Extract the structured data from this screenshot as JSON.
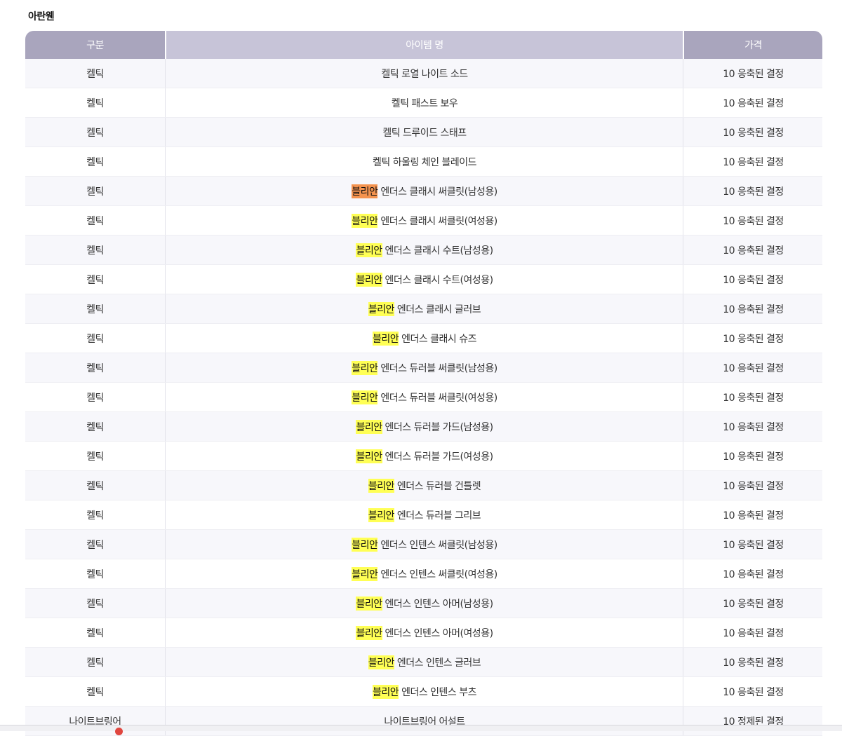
{
  "section_title": "아란웬",
  "table": {
    "headers": [
      "구분",
      "아이템 명",
      "가격"
    ],
    "rows": [
      {
        "category": "켈틱",
        "highlight": "",
        "name": "켈틱 로열 나이트 소드",
        "price": "10 응축된 결정"
      },
      {
        "category": "켈틱",
        "highlight": "",
        "name": "켈틱 패스트 보우",
        "price": "10 응축된 결정"
      },
      {
        "category": "켈틱",
        "highlight": "",
        "name": "켈틱 드루이드 스태프",
        "price": "10 응축된 결정"
      },
      {
        "category": "켈틱",
        "highlight": "",
        "name": "켈틱 하울링 체인 블레이드",
        "price": "10 응축된 결정"
      },
      {
        "category": "켈틱",
        "highlight": "블리안",
        "highlight_color": "orange",
        "name": " 엔더스 클래시 써클릿(남성용)",
        "price": "10 응축된 결정"
      },
      {
        "category": "켈틱",
        "highlight": "블리안",
        "name": " 엔더스 클래시 써클릿(여성용)",
        "price": "10 응축된 결정"
      },
      {
        "category": "켈틱",
        "highlight": "블리안",
        "name": " 엔더스 클래시 수트(남성용)",
        "price": "10 응축된 결정"
      },
      {
        "category": "켈틱",
        "highlight": "블리안",
        "name": " 엔더스 클래시 수트(여성용)",
        "price": "10 응축된 결정"
      },
      {
        "category": "켈틱",
        "highlight": "블리안",
        "name": " 엔더스 클래시 글러브",
        "price": "10 응축된 결정"
      },
      {
        "category": "켈틱",
        "highlight": "블리안",
        "name": " 엔더스 클래시 슈즈",
        "price": "10 응축된 결정"
      },
      {
        "category": "켈틱",
        "highlight": "블리안",
        "name": " 엔더스 듀러블 써클릿(남성용)",
        "price": "10 응축된 결정"
      },
      {
        "category": "켈틱",
        "highlight": "블리안",
        "name": " 엔더스 듀러블 써클릿(여성용)",
        "price": "10 응축된 결정"
      },
      {
        "category": "켈틱",
        "highlight": "블리안",
        "name": " 엔더스 듀러블 가드(남성용)",
        "price": "10 응축된 결정"
      },
      {
        "category": "켈틱",
        "highlight": "블리안",
        "name": " 엔더스 듀러블 가드(여성용)",
        "price": "10 응축된 결정"
      },
      {
        "category": "켈틱",
        "highlight": "블리안",
        "name": " 엔더스 듀러블 건틀렛",
        "price": "10 응축된 결정"
      },
      {
        "category": "켈틱",
        "highlight": "블리안",
        "name": " 엔더스 듀러블 그리브",
        "price": "10 응축된 결정"
      },
      {
        "category": "켈틱",
        "highlight": "블리안",
        "name": " 엔더스 인텐스 써클릿(남성용)",
        "price": "10 응축된 결정"
      },
      {
        "category": "켈틱",
        "highlight": "블리안",
        "name": " 엔더스 인텐스 써클릿(여성용)",
        "price": "10 응축된 결정"
      },
      {
        "category": "켈틱",
        "highlight": "블리안",
        "name": " 엔더스 인텐스 아머(남성용)",
        "price": "10 응축된 결정"
      },
      {
        "category": "켈틱",
        "highlight": "블리안",
        "name": " 엔더스 인텐스 아머(여성용)",
        "price": "10 응축된 결정"
      },
      {
        "category": "켈틱",
        "highlight": "블리안",
        "name": " 엔더스 인텐스 글러브",
        "price": "10 응축된 결정"
      },
      {
        "category": "켈틱",
        "highlight": "블리안",
        "name": " 엔더스 인텐스 부츠",
        "price": "10 응축된 결정"
      },
      {
        "category": "나이트브링어",
        "highlight": "",
        "name": "나이트브링어 어설트",
        "price": "10 정제된 결정"
      }
    ]
  },
  "colors": {
    "header_dark": "#a9a5bd",
    "header_light": "#c7c4d8",
    "highlight_yellow": "#ffff55",
    "highlight_orange": "#f4934f"
  }
}
